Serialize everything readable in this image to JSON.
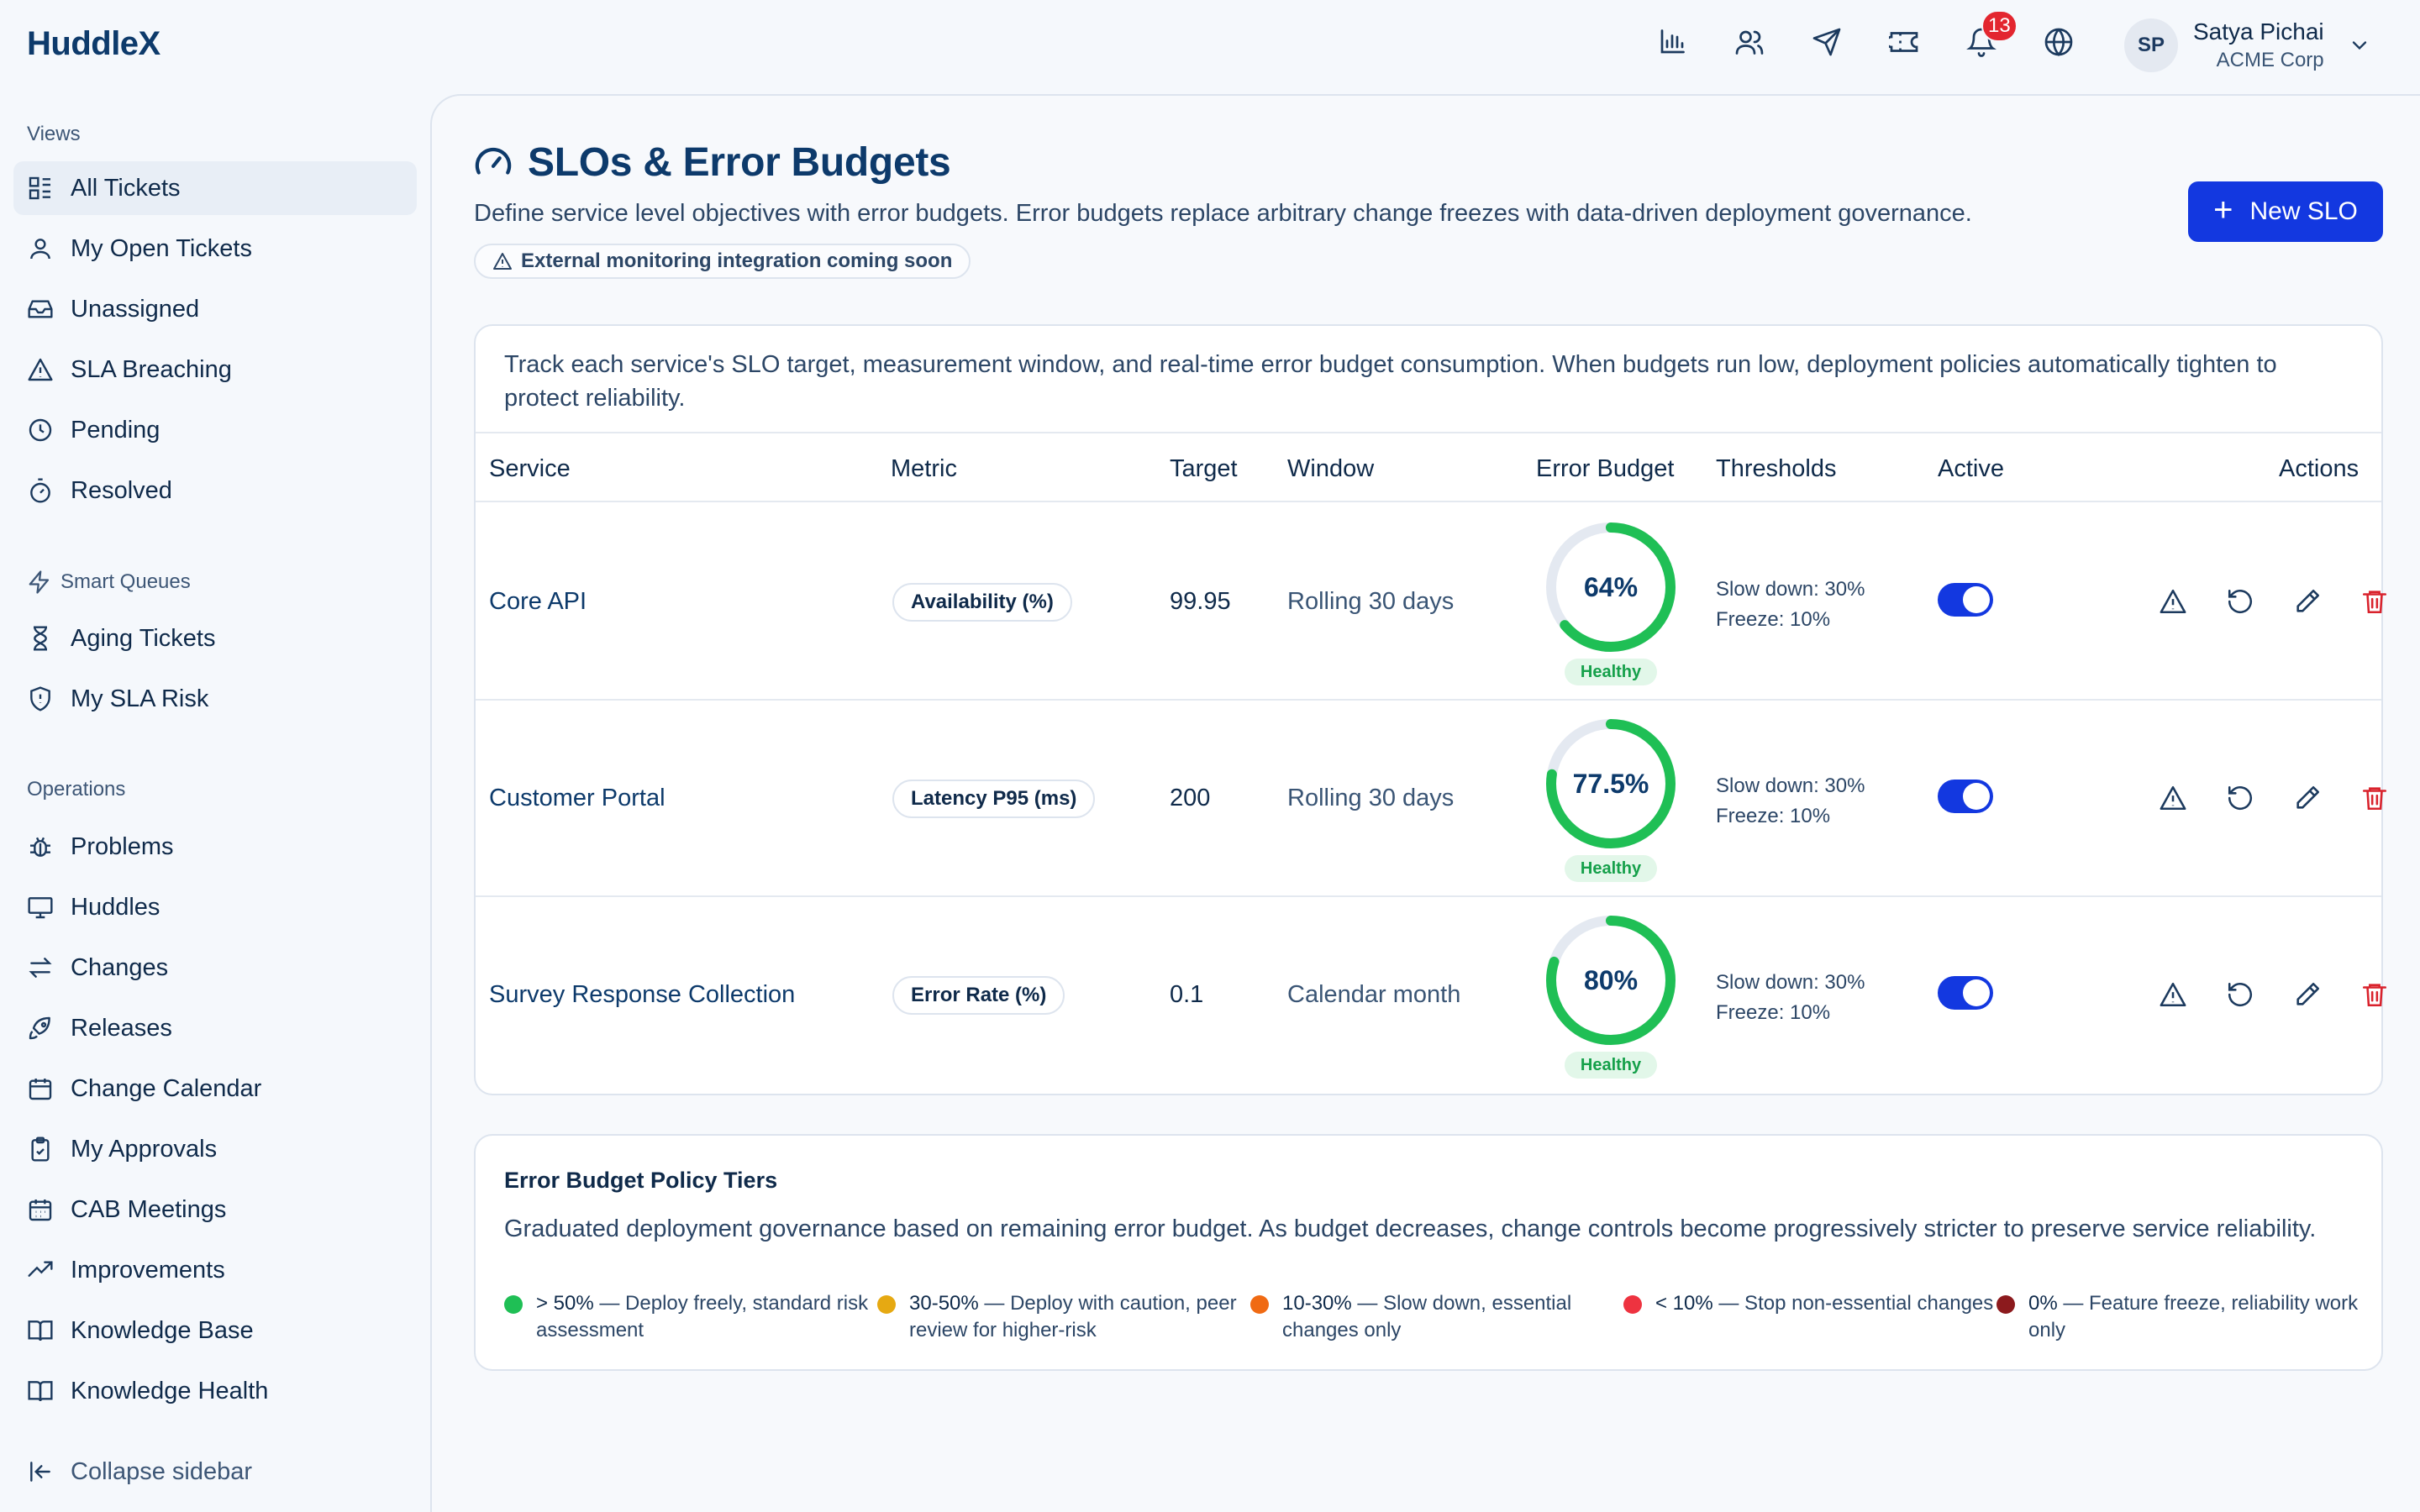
{
  "app": {
    "name": "HuddleX"
  },
  "topbar": {
    "icons": [
      "bar-chart-icon",
      "users-icon",
      "send-icon",
      "ticket-icon",
      "bell-icon",
      "globe-icon"
    ],
    "notifications_count": "13",
    "user": {
      "initials": "SP",
      "name": "Satya Pichai",
      "org": "ACME Corp"
    }
  },
  "sidebar": {
    "views_label": "Views",
    "views": [
      {
        "label": "All Tickets",
        "icon": "grid-list-icon"
      },
      {
        "label": "My Open Tickets",
        "icon": "user-icon"
      },
      {
        "label": "Unassigned",
        "icon": "inbox-icon"
      },
      {
        "label": "SLA Breaching",
        "icon": "warning-icon"
      },
      {
        "label": "Pending",
        "icon": "clock-icon"
      },
      {
        "label": "Resolved",
        "icon": "timer-icon"
      }
    ],
    "smart_queues_label": "Smart Queues",
    "smart_queues": [
      {
        "label": "Aging Tickets",
        "icon": "hourglass-icon"
      },
      {
        "label": "My SLA Risk",
        "icon": "shield-icon"
      }
    ],
    "operations_label": "Operations",
    "operations": [
      {
        "label": "Problems",
        "icon": "bug-icon"
      },
      {
        "label": "Huddles",
        "icon": "monitor-icon"
      },
      {
        "label": "Changes",
        "icon": "arrows-swap-icon"
      },
      {
        "label": "Releases",
        "icon": "rocket-icon"
      },
      {
        "label": "Change Calendar",
        "icon": "calendar-icon"
      },
      {
        "label": "My Approvals",
        "icon": "clipboard-check-icon"
      },
      {
        "label": "CAB Meetings",
        "icon": "calendar-grid-icon"
      },
      {
        "label": "Improvements",
        "icon": "trend-up-icon"
      },
      {
        "label": "Knowledge Base",
        "icon": "book-open-icon"
      },
      {
        "label": "Knowledge Health",
        "icon": "book-icon"
      }
    ],
    "collapse_label": "Collapse sidebar"
  },
  "page": {
    "title": "SLOs & Error Budgets",
    "description": "Define service level objectives with error budgets. Error budgets replace arbitrary change freezes with data-driven deployment governance.",
    "notice": "External monitoring integration coming soon",
    "new_button": "New SLO"
  },
  "slo_table": {
    "intro": "Track each service's SLO target, measurement window, and real-time error budget consumption. When budgets run low, deployment policies automatically tighten to protect reliability.",
    "columns": [
      "Service",
      "Metric",
      "Target",
      "Window",
      "Error Budget",
      "Thresholds",
      "Active",
      "Actions"
    ],
    "rows": [
      {
        "service": "Core API",
        "metric": "Availability (%)",
        "target": "99.95",
        "window": "Rolling 30 days",
        "budget_label": "64%",
        "budget_fraction": 0.64,
        "status": "Healthy",
        "slow_down": "Slow down: 30%",
        "freeze": "Freeze: 10%",
        "active": true
      },
      {
        "service": "Customer Portal",
        "metric": "Latency P95 (ms)",
        "target": "200",
        "window": "Rolling 30 days",
        "budget_label": "77.5%",
        "budget_fraction": 0.775,
        "status": "Healthy",
        "slow_down": "Slow down: 30%",
        "freeze": "Freeze: 10%",
        "active": true
      },
      {
        "service": "Survey Response Collection",
        "metric": "Error Rate (%)",
        "target": "0.1",
        "window": "Calendar month",
        "budget_label": "80%",
        "budget_fraction": 0.8,
        "status": "Healthy",
        "slow_down": "Slow down: 30%",
        "freeze": "Freeze: 10%",
        "active": true
      }
    ]
  },
  "policy": {
    "title": "Error Budget Policy Tiers",
    "description": "Graduated deployment governance based on remaining error budget. As budget decreases, change controls become progressively stricter to preserve service reliability.",
    "tiers": [
      {
        "range": "> 50%",
        "text": " — Deploy freely, standard risk assessment",
        "color": "#1fbf55"
      },
      {
        "range": "30-50%",
        "text": " — Deploy with caution, peer review for higher-risk",
        "color": "#e6a912"
      },
      {
        "range": "10-30%",
        "text": " — Slow down, essential changes only",
        "color": "#f06a13"
      },
      {
        "range": "< 10%",
        "text": " — Stop non-essential changes",
        "color": "#ee3340"
      },
      {
        "range": "0%",
        "text": " — Feature freeze, reliability work only",
        "color": "#8c1a1d"
      }
    ]
  },
  "colors": {
    "accent": "#1338e0",
    "healthy": "#1fbf55",
    "danger": "#d9222c",
    "brand": "#0d3a6b"
  }
}
